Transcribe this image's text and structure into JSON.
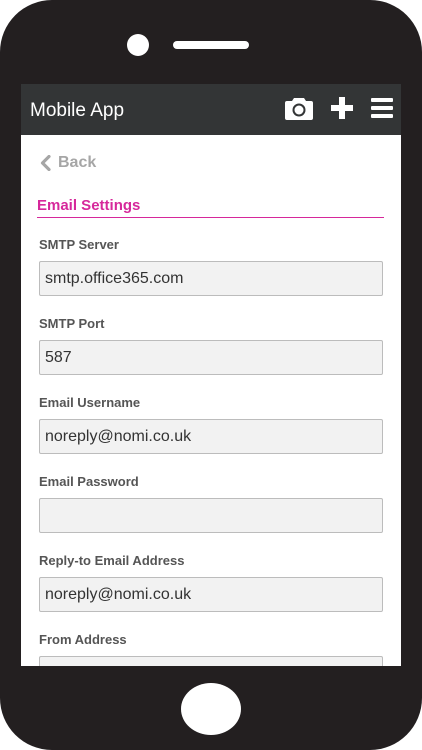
{
  "header": {
    "title": "Mobile App",
    "icons": [
      "camera-icon",
      "plus-icon",
      "menu-icon"
    ]
  },
  "nav": {
    "back_label": "Back"
  },
  "section": {
    "title": "Email Settings"
  },
  "fields": [
    {
      "label": "SMTP Server",
      "value": "smtp.office365.com"
    },
    {
      "label": "SMTP Port",
      "value": "587"
    },
    {
      "label": "Email Username",
      "value": "noreply@nomi.co.uk"
    },
    {
      "label": "Email Password",
      "value": ""
    },
    {
      "label": "Reply-to Email Address",
      "value": "noreply@nomi.co.uk"
    },
    {
      "label": "From Address",
      "value": ""
    }
  ],
  "colors": {
    "accent": "#d6289b",
    "header_bg": "#333536",
    "device_body": "#231f20"
  }
}
